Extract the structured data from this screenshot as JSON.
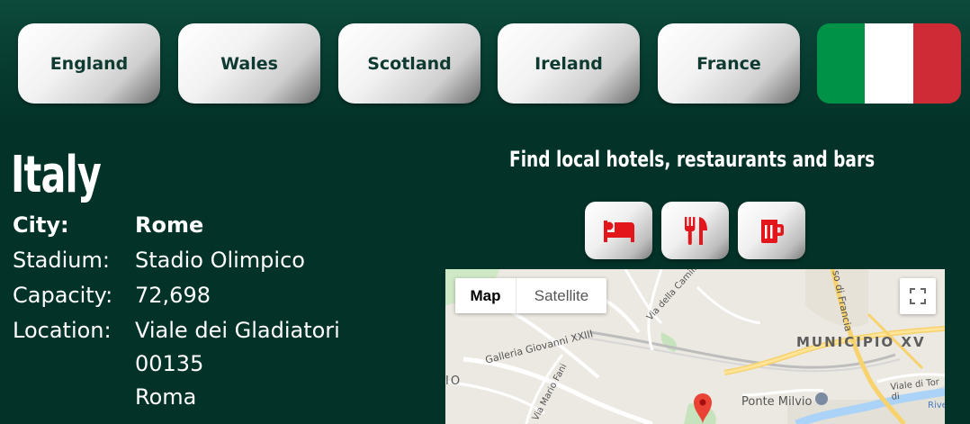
{
  "nav": {
    "buttons": [
      "England",
      "Wales",
      "Scotland",
      "Ireland",
      "France"
    ],
    "active_flag": {
      "colors": [
        "#009246",
        "#ffffff",
        "#ce2b37"
      ]
    }
  },
  "country": {
    "title": "Italy",
    "fields": {
      "city_label": "City:",
      "city_value": "Rome",
      "stadium_label": "Stadium:",
      "stadium_value": "Stadio Olimpico",
      "capacity_label": "Capacity:",
      "capacity_value": "72,698",
      "location_label": "Location:",
      "location_line1": "Viale dei Gladiatori",
      "location_line2": "00135",
      "location_line3": "Roma"
    }
  },
  "find": {
    "heading": "Find local hotels, restaurants and bars",
    "icons": [
      "bed-icon",
      "cutlery-icon",
      "beer-mug-icon"
    ],
    "icon_color": "#e3161b"
  },
  "map": {
    "tab_map": "Map",
    "tab_satellite": "Satellite",
    "labels": {
      "district": "MUNICIPIO XV",
      "galleria": "Galleria Giovanni XXIII",
      "ponte": "Ponte Milvio",
      "via_camillu": "Via della Camillu",
      "via_mario": "Via Mario Fani",
      "corso": "so di Francia",
      "viale_tor": "Viale di Tor di",
      "rive": "Rive",
      "partial": "IO"
    }
  }
}
